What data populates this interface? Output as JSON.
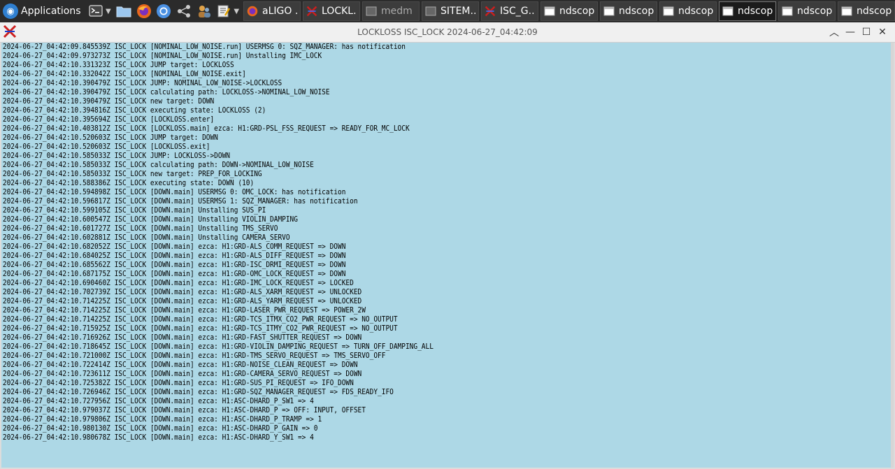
{
  "panel": {
    "applications_label": "Applications",
    "tasks": [
      {
        "label": "aLIGO ...",
        "icon": "firefox-icon",
        "active": false
      },
      {
        "label": "LOCKL...",
        "icon": "guardian-x-icon",
        "active": false
      },
      {
        "label": "medm",
        "icon": "medm-window-icon",
        "active": false,
        "dim": true
      },
      {
        "label": "SITEM...",
        "icon": "medm-window-icon",
        "active": false
      },
      {
        "label": "ISC_G...",
        "icon": "guardian-x-icon",
        "active": false
      },
      {
        "label": "ndscop...",
        "icon": "ndscope-window-icon",
        "active": false
      },
      {
        "label": "ndscop...",
        "icon": "ndscope-window-icon",
        "active": false
      },
      {
        "label": "ndscop...",
        "icon": "ndscope-window-icon",
        "active": false
      },
      {
        "label": "ndscop...",
        "icon": "ndscope-window-icon",
        "active": true
      },
      {
        "label": "ndscop...",
        "icon": "ndscope-window-icon",
        "active": false
      },
      {
        "label": "ndscop...",
        "icon": "ndscope-window-icon",
        "active": false
      }
    ]
  },
  "window": {
    "title": "LOCKLOSS ISC_LOCK 2024-06-27_04:42:09",
    "background": "#add8e6"
  },
  "log": [
    "2024-06-27_04:42:09.845539Z ISC_LOCK [NOMINAL_LOW_NOISE.run] USERMSG 0: SQZ_MANAGER: has notification",
    "2024-06-27_04:42:09.973273Z ISC_LOCK [NOMINAL_LOW_NOISE.run] Unstalling IMC_LOCK",
    "2024-06-27_04:42:10.331323Z ISC_LOCK JUMP target: LOCKLOSS",
    "2024-06-27_04:42:10.332042Z ISC_LOCK [NOMINAL_LOW_NOISE.exit]",
    "2024-06-27_04:42:10.390479Z ISC_LOCK JUMP: NOMINAL_LOW_NOISE->LOCKLOSS",
    "2024-06-27_04:42:10.390479Z ISC_LOCK calculating path: LOCKLOSS->NOMINAL_LOW_NOISE",
    "2024-06-27_04:42:10.390479Z ISC_LOCK new target: DOWN",
    "2024-06-27_04:42:10.394816Z ISC_LOCK executing state: LOCKLOSS (2)",
    "2024-06-27_04:42:10.395694Z ISC_LOCK [LOCKLOSS.enter]",
    "2024-06-27_04:42:10.403812Z ISC_LOCK [LOCKLOSS.main] ezca: H1:GRD-PSL_FSS_REQUEST => READY_FOR_MC_LOCK",
    "2024-06-27_04:42:10.520603Z ISC_LOCK JUMP target: DOWN",
    "2024-06-27_04:42:10.520603Z ISC_LOCK [LOCKLOSS.exit]",
    "2024-06-27_04:42:10.585033Z ISC_LOCK JUMP: LOCKLOSS->DOWN",
    "2024-06-27_04:42:10.585033Z ISC_LOCK calculating path: DOWN->NOMINAL_LOW_NOISE",
    "2024-06-27_04:42:10.585033Z ISC_LOCK new target: PREP_FOR_LOCKING",
    "2024-06-27_04:42:10.588386Z ISC_LOCK executing state: DOWN (10)",
    "2024-06-27_04:42:10.594898Z ISC_LOCK [DOWN.main] USERMSG 0: OMC_LOCK: has notification",
    "2024-06-27_04:42:10.596817Z ISC_LOCK [DOWN.main] USERMSG 1: SQZ_MANAGER: has notification",
    "2024-06-27_04:42:10.599105Z ISC_LOCK [DOWN.main] Unstalling SUS_PI",
    "2024-06-27_04:42:10.600547Z ISC_LOCK [DOWN.main] Unstalling VIOLIN_DAMPING",
    "2024-06-27_04:42:10.601727Z ISC_LOCK [DOWN.main] Unstalling TMS_SERVO",
    "2024-06-27_04:42:10.602881Z ISC_LOCK [DOWN.main] Unstalling CAMERA_SERVO",
    "2024-06-27_04:42:10.682052Z ISC_LOCK [DOWN.main] ezca: H1:GRD-ALS_COMM_REQUEST => DOWN",
    "2024-06-27_04:42:10.684025Z ISC_LOCK [DOWN.main] ezca: H1:GRD-ALS_DIFF_REQUEST => DOWN",
    "2024-06-27_04:42:10.685562Z ISC_LOCK [DOWN.main] ezca: H1:GRD-ISC_DRMI_REQUEST => DOWN",
    "2024-06-27_04:42:10.687175Z ISC_LOCK [DOWN.main] ezca: H1:GRD-OMC_LOCK_REQUEST => DOWN",
    "2024-06-27_04:42:10.690460Z ISC_LOCK [DOWN.main] ezca: H1:GRD-IMC_LOCK_REQUEST => LOCKED",
    "2024-06-27_04:42:10.702739Z ISC_LOCK [DOWN.main] ezca: H1:GRD-ALS_XARM_REQUEST => UNLOCKED",
    "2024-06-27_04:42:10.714225Z ISC_LOCK [DOWN.main] ezca: H1:GRD-ALS_YARM_REQUEST => UNLOCKED",
    "2024-06-27_04:42:10.714225Z ISC_LOCK [DOWN.main] ezca: H1:GRD-LASER_PWR_REQUEST => POWER_2W",
    "2024-06-27_04:42:10.714225Z ISC_LOCK [DOWN.main] ezca: H1:GRD-TCS_ITMX_CO2_PWR_REQUEST => NO_OUTPUT",
    "2024-06-27_04:42:10.715925Z ISC_LOCK [DOWN.main] ezca: H1:GRD-TCS_ITMY_CO2_PWR_REQUEST => NO_OUTPUT",
    "2024-06-27_04:42:10.716926Z ISC_LOCK [DOWN.main] ezca: H1:GRD-FAST_SHUTTER_REQUEST => DOWN",
    "2024-06-27_04:42:10.718645Z ISC_LOCK [DOWN.main] ezca: H1:GRD-VIOLIN_DAMPING_REQUEST => TURN_OFF_DAMPING_ALL",
    "2024-06-27_04:42:10.721000Z ISC_LOCK [DOWN.main] ezca: H1:GRD-TMS_SERVO_REQUEST => TMS_SERVO_OFF",
    "2024-06-27_04:42:10.722414Z ISC_LOCK [DOWN.main] ezca: H1:GRD-NOISE_CLEAN_REQUEST => DOWN",
    "2024-06-27_04:42:10.723611Z ISC_LOCK [DOWN.main] ezca: H1:GRD-CAMERA_SERVO_REQUEST => DOWN",
    "2024-06-27_04:42:10.725382Z ISC_LOCK [DOWN.main] ezca: H1:GRD-SUS_PI_REQUEST => IFO_DOWN",
    "2024-06-27_04:42:10.726946Z ISC_LOCK [DOWN.main] ezca: H1:GRD-SQZ_MANAGER_REQUEST => FDS_READY_IFO",
    "2024-06-27_04:42:10.727956Z ISC_LOCK [DOWN.main] ezca: H1:ASC-DHARD_P_SW1 => 4",
    "2024-06-27_04:42:10.979037Z ISC_LOCK [DOWN.main] ezca: H1:ASC-DHARD_P => OFF: INPUT, OFFSET",
    "2024-06-27_04:42:10.979806Z ISC_LOCK [DOWN.main] ezca: H1:ASC-DHARD_P_TRAMP => 1",
    "2024-06-27_04:42:10.980130Z ISC_LOCK [DOWN.main] ezca: H1:ASC-DHARD_P_GAIN => 0",
    "2024-06-27_04:42:10.980678Z ISC_LOCK [DOWN.main] ezca: H1:ASC-DHARD_Y_SW1 => 4"
  ]
}
